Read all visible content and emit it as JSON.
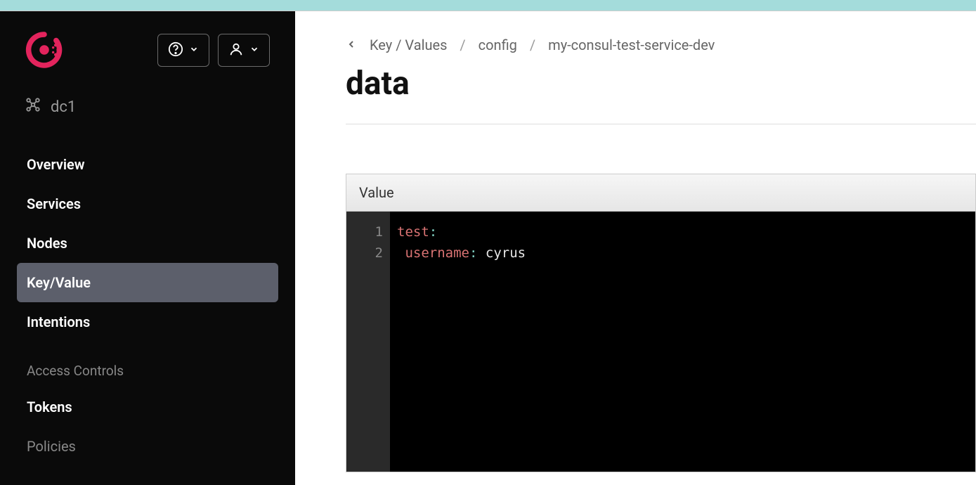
{
  "datacenter": "dc1",
  "nav": {
    "items": [
      {
        "label": "Overview",
        "active": false
      },
      {
        "label": "Services",
        "active": false
      },
      {
        "label": "Nodes",
        "active": false
      },
      {
        "label": "Key/Value",
        "active": true
      },
      {
        "label": "Intentions",
        "active": false
      }
    ],
    "access_section_label": "Access Controls",
    "access_items": [
      {
        "label": "Tokens",
        "dim": false
      },
      {
        "label": "Policies",
        "dim": true
      }
    ]
  },
  "breadcrumb": {
    "parts": [
      "Key / Values",
      "config",
      "my-consul-test-service-dev"
    ]
  },
  "page_title": "data",
  "value_panel": {
    "header": "Value"
  },
  "editor": {
    "lines": [
      {
        "num": "1",
        "tokens": [
          {
            "t": "key1",
            "v": "test"
          },
          {
            "t": "punct",
            "v": ":"
          }
        ]
      },
      {
        "num": "2",
        "tokens": [
          {
            "t": "indent",
            "v": " "
          },
          {
            "t": "key2",
            "v": "username"
          },
          {
            "t": "punct",
            "v": ":"
          },
          {
            "t": "space",
            "v": " "
          },
          {
            "t": "val",
            "v": "cyrus"
          }
        ]
      }
    ]
  },
  "colors": {
    "brand": "#e3245d"
  }
}
